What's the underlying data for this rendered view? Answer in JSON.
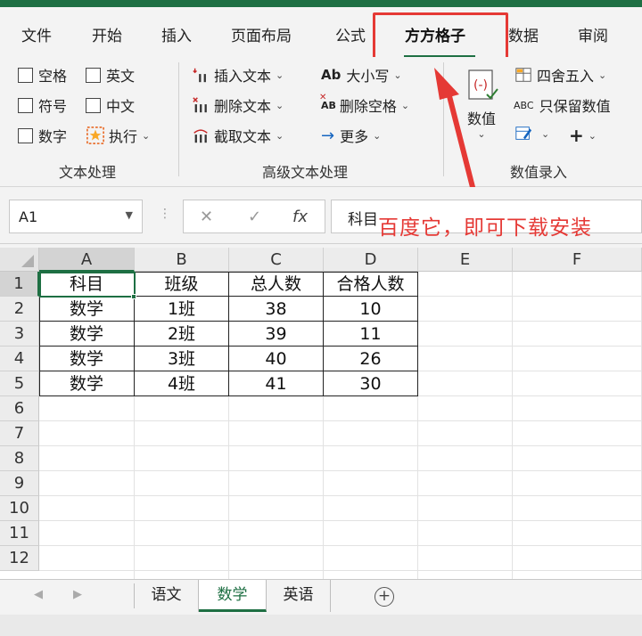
{
  "ribbon_tabs": [
    {
      "label": "文件"
    },
    {
      "label": "开始"
    },
    {
      "label": "插入"
    },
    {
      "label": "页面布局"
    },
    {
      "label": "公式"
    },
    {
      "label": "方方格子"
    },
    {
      "label": "数据"
    },
    {
      "label": "审阅"
    }
  ],
  "active_tab": "方方格子",
  "ribbon": {
    "text_group": {
      "label": "文本处理",
      "checkboxes": [
        "空格",
        "英文",
        "符号",
        "中文",
        "数字"
      ],
      "execute": "执行"
    },
    "advanced_group": {
      "label": "高级文本处理",
      "insert_text": "插入文本",
      "delete_text": "删除文本",
      "extract_text": "截取文本",
      "case": "大小写",
      "delete_space": "删除空格",
      "more": "更多",
      "ab_icon": "Ab",
      "ab_small_icon": "AB"
    },
    "numeric_group": {
      "label": "数值录入",
      "numeric": "数值",
      "round": "四舍五入",
      "keep_values": "只保留数值",
      "abc_icon": "ABC",
      "plus": "+"
    }
  },
  "formula_bar": {
    "name_box": "A1",
    "cancel": "✕",
    "enter": "✓",
    "fx": "fx",
    "content": "科目"
  },
  "annotation": "百度它，即可下载安装",
  "columns": [
    "A",
    "B",
    "C",
    "D",
    "E",
    "F"
  ],
  "rows": [
    "1",
    "2",
    "3",
    "4",
    "5",
    "6",
    "7",
    "8",
    "9",
    "10",
    "11",
    "12"
  ],
  "table": [
    [
      "科目",
      "班级",
      "总人数",
      "合格人数"
    ],
    [
      "数学",
      "1班",
      "38",
      "10"
    ],
    [
      "数学",
      "2班",
      "39",
      "11"
    ],
    [
      "数学",
      "3班",
      "40",
      "26"
    ],
    [
      "数学",
      "4班",
      "41",
      "30"
    ]
  ],
  "sheets": [
    "语文",
    "数学",
    "英语"
  ],
  "active_sheet": "数学",
  "colors": {
    "accent": "#1e6f43",
    "annotation": "#e53935"
  }
}
